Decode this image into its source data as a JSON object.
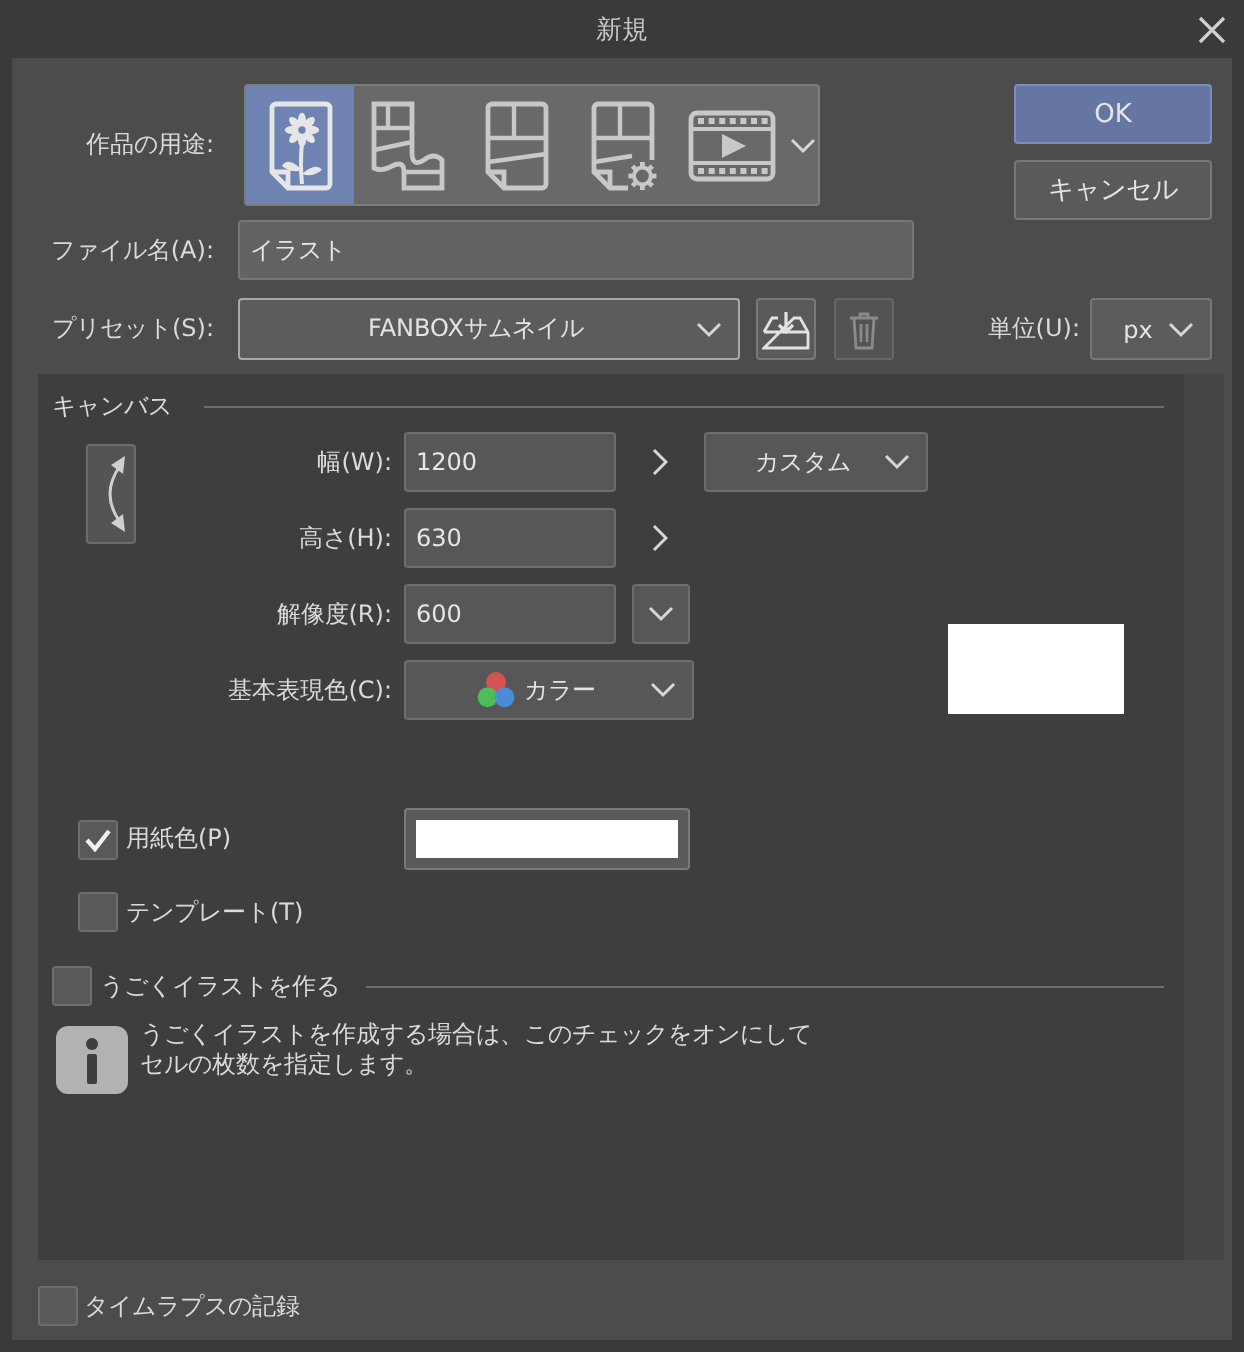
{
  "window": {
    "title": "新規"
  },
  "purpose": {
    "label": "作品の用途:",
    "options": [
      {
        "kind": "illustration",
        "selected": true
      },
      {
        "kind": "webtoon",
        "selected": false
      },
      {
        "kind": "comic",
        "selected": false
      },
      {
        "kind": "comic_settings",
        "selected": false
      },
      {
        "kind": "animation",
        "selected": false
      }
    ]
  },
  "buttons": [
    {
      "kind": "primary",
      "label": "OK"
    },
    {
      "kind": "secondary",
      "label": "キャンセル"
    }
  ],
  "file_name": {
    "label": "ファイル名(A):",
    "value": "イラスト"
  },
  "preset": {
    "label": "プリセット(S):",
    "value": "FANBOXサムネイル",
    "delete_disabled": true
  },
  "unit": {
    "label": "単位(U):",
    "value": "px"
  },
  "canvas": {
    "title": "キャンバス",
    "width": {
      "label": "幅(W):",
      "value": "1200"
    },
    "size_preset": {
      "value": "カスタム"
    },
    "height": {
      "label": "高さ(H):",
      "value": "630"
    },
    "resolution": {
      "label": "解像度(R):",
      "value": "600"
    },
    "color_mode": {
      "label": "基本表現色(C):",
      "value": "カラー"
    },
    "paper_color": {
      "label": "用紙色(P)",
      "checked": true
    },
    "template": {
      "label": "テンプレート(T)",
      "checked": false
    }
  },
  "animation": {
    "label": "うごくイラストを作る",
    "checked": false,
    "info": "うごくイラストを作成する場合は、このチェックをオンにしてセルの枚数を指定します。"
  },
  "timelapse": {
    "label": "タイムラプスの記録",
    "checked": false
  }
}
